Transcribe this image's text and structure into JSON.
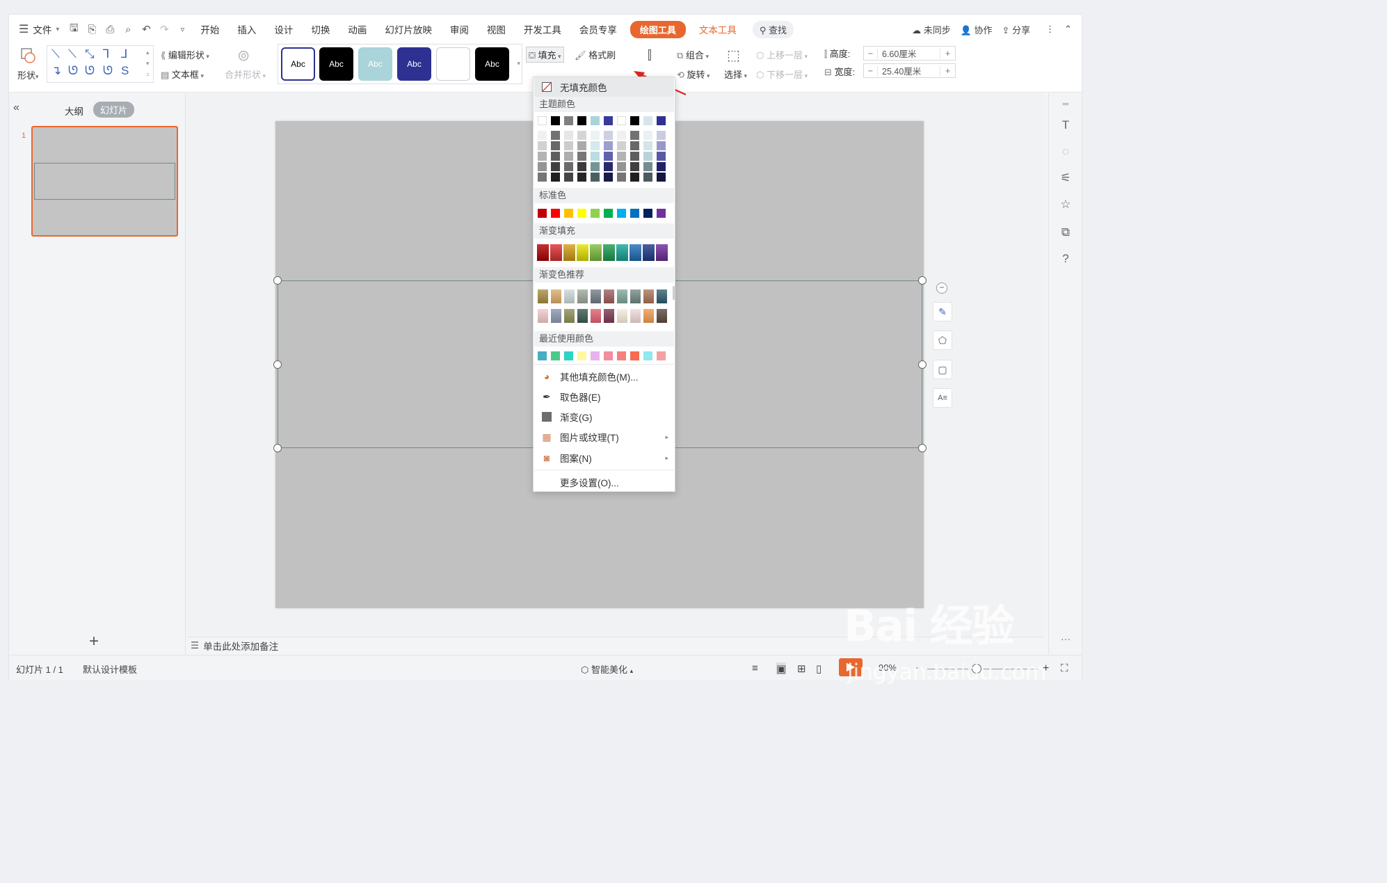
{
  "menubar": {
    "file_label": "文件",
    "tabs": [
      "开始",
      "插入",
      "设计",
      "切换",
      "动画",
      "幻灯片放映",
      "审阅",
      "视图",
      "开发工具",
      "会员专享"
    ],
    "active_tab": "绘图工具",
    "text_tool_tab": "文本工具",
    "search_label": "查找",
    "sync_label": "未同步",
    "collab_label": "协作",
    "share_label": "分享"
  },
  "ribbon": {
    "shape_label": "形状",
    "edit_shape_label": "编辑形状",
    "textbox_label": "文本框",
    "merge_shape_label": "合并形状",
    "style_samples": [
      "Abc",
      "Abc",
      "Abc",
      "Abc",
      "",
      "Abc"
    ],
    "fill_label": "填充",
    "format_painter_label": "格式刷",
    "group_label": "组合",
    "rotate_label": "旋转",
    "select_label": "选择",
    "bring_forward_label": "上移一层",
    "send_backward_label": "下移一层",
    "height_label": "高度:",
    "height_value": "6.60厘米",
    "width_label": "宽度:",
    "width_value": "25.40厘米"
  },
  "left_pane": {
    "outline_tab": "大纲",
    "slides_tab": "幻灯片",
    "slide_number": "1"
  },
  "fill_menu": {
    "no_fill": "无填充颜色",
    "theme_colors_header": "主题颜色",
    "standard_colors_header": "标准色",
    "gradient_fill_header": "渐变填充",
    "gradient_recommend_header": "渐变色推荐",
    "recent_colors_header": "最近使用颜色",
    "more_fill_colors": "其他填充颜色(M)...",
    "eyedropper": "取色器(E)",
    "gradient": "渐变(G)",
    "picture_texture": "图片或纹理(T)",
    "pattern": "图案(N)",
    "more_settings": "更多设置(O)...",
    "theme_top_row": [
      "#ffffff",
      "#000000",
      "#7f7f7f",
      "#000000",
      "#a9d4d9",
      "#3a3a9c",
      "#ffffff",
      "#000000",
      "#d6e5ea",
      "#2e3192"
    ],
    "standard_colors": [
      "#c00000",
      "#ff0000",
      "#ffc000",
      "#ffff00",
      "#92d050",
      "#00b050",
      "#00b0f0",
      "#0070c0",
      "#002060",
      "#7030a0"
    ],
    "gradient_fills": [
      "#b30000",
      "#e03030",
      "#d4a017",
      "#e6e600",
      "#7fc040",
      "#1a9e50",
      "#15a89a",
      "#1f6fba",
      "#1f3a8a",
      "#6f2c9a"
    ],
    "gradient_recommend_row1": [
      "#a48a3c",
      "#d9a866",
      "#c9d6d6",
      "#9aa596",
      "#6e7885",
      "#9c5a5a",
      "#7aa596",
      "#6e8580",
      "#a87050",
      "#2a5a6a"
    ],
    "gradient_recommend_row2": [
      "#f0c8c8",
      "#8c96b0",
      "#8c8f58",
      "#3a5a50",
      "#e06070",
      "#7a3a50",
      "#f5ecd8",
      "#f0d8d8",
      "#f09a50",
      "#5a4a40"
    ],
    "recent_colors": [
      "#4bacc6",
      "#4dc98a",
      "#2ed3c4",
      "#fff8a0",
      "#e6b3f0",
      "#f58da0",
      "#f58080",
      "#f56a50",
      "#90e8f0",
      "#f5a0a0"
    ]
  },
  "notes_placeholder": "单击此处添加备注",
  "status": {
    "slide_count": "幻灯片 1 / 1",
    "template": "默认设计模板",
    "beautify": "智能美化",
    "zoom": "90%"
  },
  "watermark": {
    "brand": "Bai 经验",
    "url": "jingyan.baidu.com"
  }
}
